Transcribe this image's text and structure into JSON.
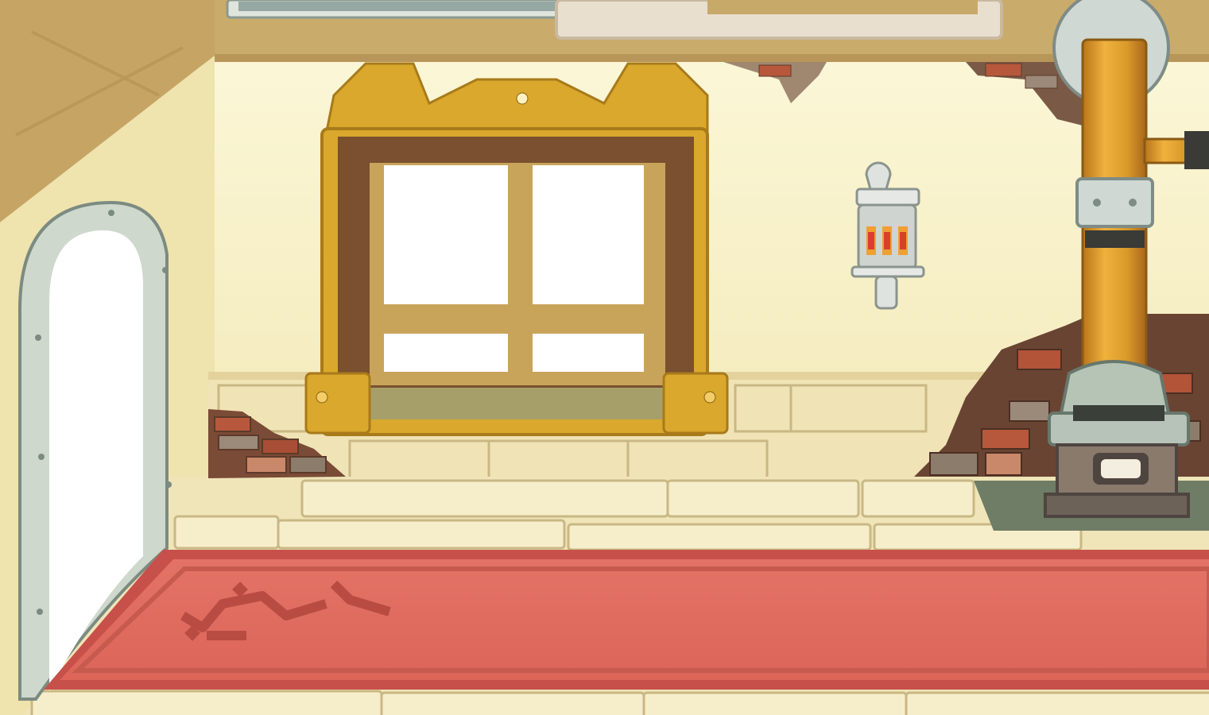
{
  "scene": {
    "kind": "game-background",
    "room": "interior",
    "elements": [
      "doorway",
      "gold-framed-window",
      "wall-lantern",
      "brass-pipe",
      "iron-stove",
      "red-rug",
      "exposed-brick",
      "stone-floor",
      "ceiling-hatches"
    ]
  },
  "palette": {
    "wall": "#f7f1c8",
    "wall_shadow": "#efe3ae",
    "ceiling": "#c7a96a",
    "wainscot": "#f0e2b4",
    "floor": "#efe5b8",
    "floor_line": "#c9b884",
    "rug": "#e06a5e",
    "rug_border": "#c8504a",
    "window_frame": "#7a5030",
    "window_gold": "#d9a82c",
    "pipe": "#d99a2a",
    "metal": "#cfd6cc",
    "brick": "#b55a3c",
    "stove_mat": "#6f7d66"
  }
}
